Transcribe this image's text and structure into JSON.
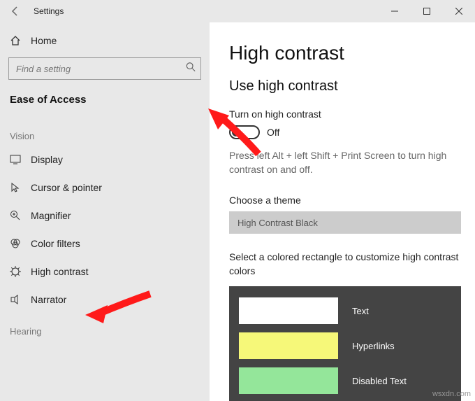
{
  "titlebar": {
    "title": "Settings"
  },
  "sidebar": {
    "home_label": "Home",
    "search_placeholder": "Find a setting",
    "category": "Ease of Access",
    "group_vision": "Vision",
    "group_hearing": "Hearing",
    "items": {
      "display": "Display",
      "cursor": "Cursor & pointer",
      "magnifier": "Magnifier",
      "color_filters": "Color filters",
      "high_contrast": "High contrast",
      "narrator": "Narrator"
    }
  },
  "main": {
    "title": "High contrast",
    "use_hc": "Use high contrast",
    "toggle_label": "Turn on high contrast",
    "toggle_state": "Off",
    "shortcut_help": "Press left Alt + left Shift + Print Screen to turn high contrast on and off.",
    "theme_label": "Choose a theme",
    "theme_selected": "High Contrast Black",
    "customize_desc": "Select a colored rectangle to customize high contrast colors",
    "rows": {
      "text": {
        "label": "Text",
        "color": "#ffffff"
      },
      "hyperlinks": {
        "label": "Hyperlinks",
        "color": "#f6f879"
      },
      "disabled": {
        "label": "Disabled Text",
        "color": "#94e69a"
      }
    }
  },
  "watermark": "wsxdn.com"
}
